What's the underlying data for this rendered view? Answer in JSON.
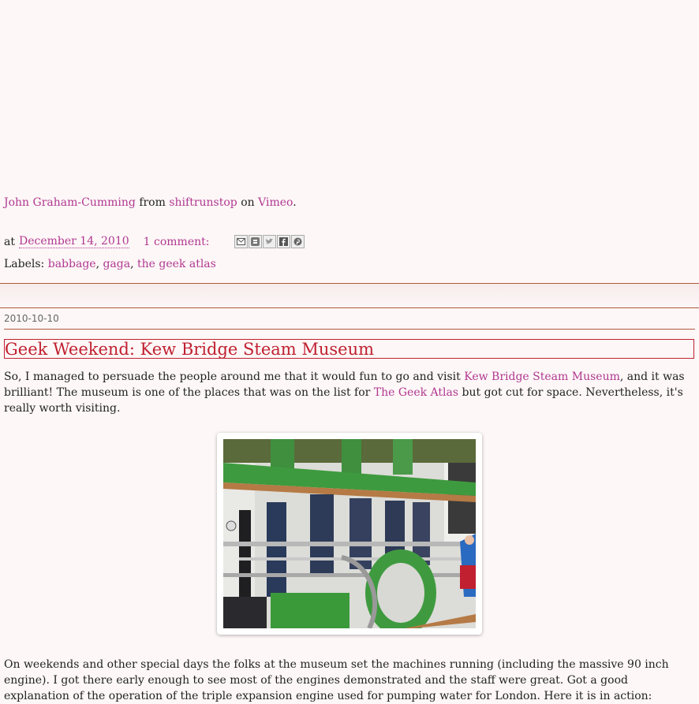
{
  "video_credit": {
    "author": "John Graham-Cumming",
    "from": "from",
    "user": "shiftrunstop",
    "on": "on",
    "site": "Vimeo",
    "period": "."
  },
  "prev_post_meta": {
    "at": "at",
    "date": "December 14, 2010",
    "comments": "1 comment:",
    "share_icons": [
      "email-icon",
      "blogger-icon",
      "twitter-icon",
      "facebook-icon",
      "pinterest-icon"
    ]
  },
  "labels": {
    "prefix": "Labels:",
    "items": [
      "babbage",
      "gaga",
      "the geek atlas"
    ],
    "separator": ","
  },
  "post": {
    "date": "2010-10-10",
    "title": "Geek Weekend: Kew Bridge Steam Museum",
    "p1_a": "So, I managed to persuade the people around me that it would fun to go and visit ",
    "p1_link1": "Kew Bridge Steam Museum",
    "p1_b": ", and it was brilliant! The museum is one of the places that was on the list for ",
    "p1_link2": "The Geek Atlas",
    "p1_c": " but got cut for space. Nevertheless, it's really worth visiting.",
    "p2": "On weekends and other special days the folks at the museum set the machines running (including the massive 90 inch engine). I got there early enough to see most of the engines demonstrated and the staff were great. Got a good explanation of the operation of the triple expansion engine used for pumping water for London. Here it is in action:"
  },
  "colors": {
    "link": "#b03890",
    "title": "#c02030",
    "divider": "#b05a3c",
    "background": "#fdf7f7"
  }
}
